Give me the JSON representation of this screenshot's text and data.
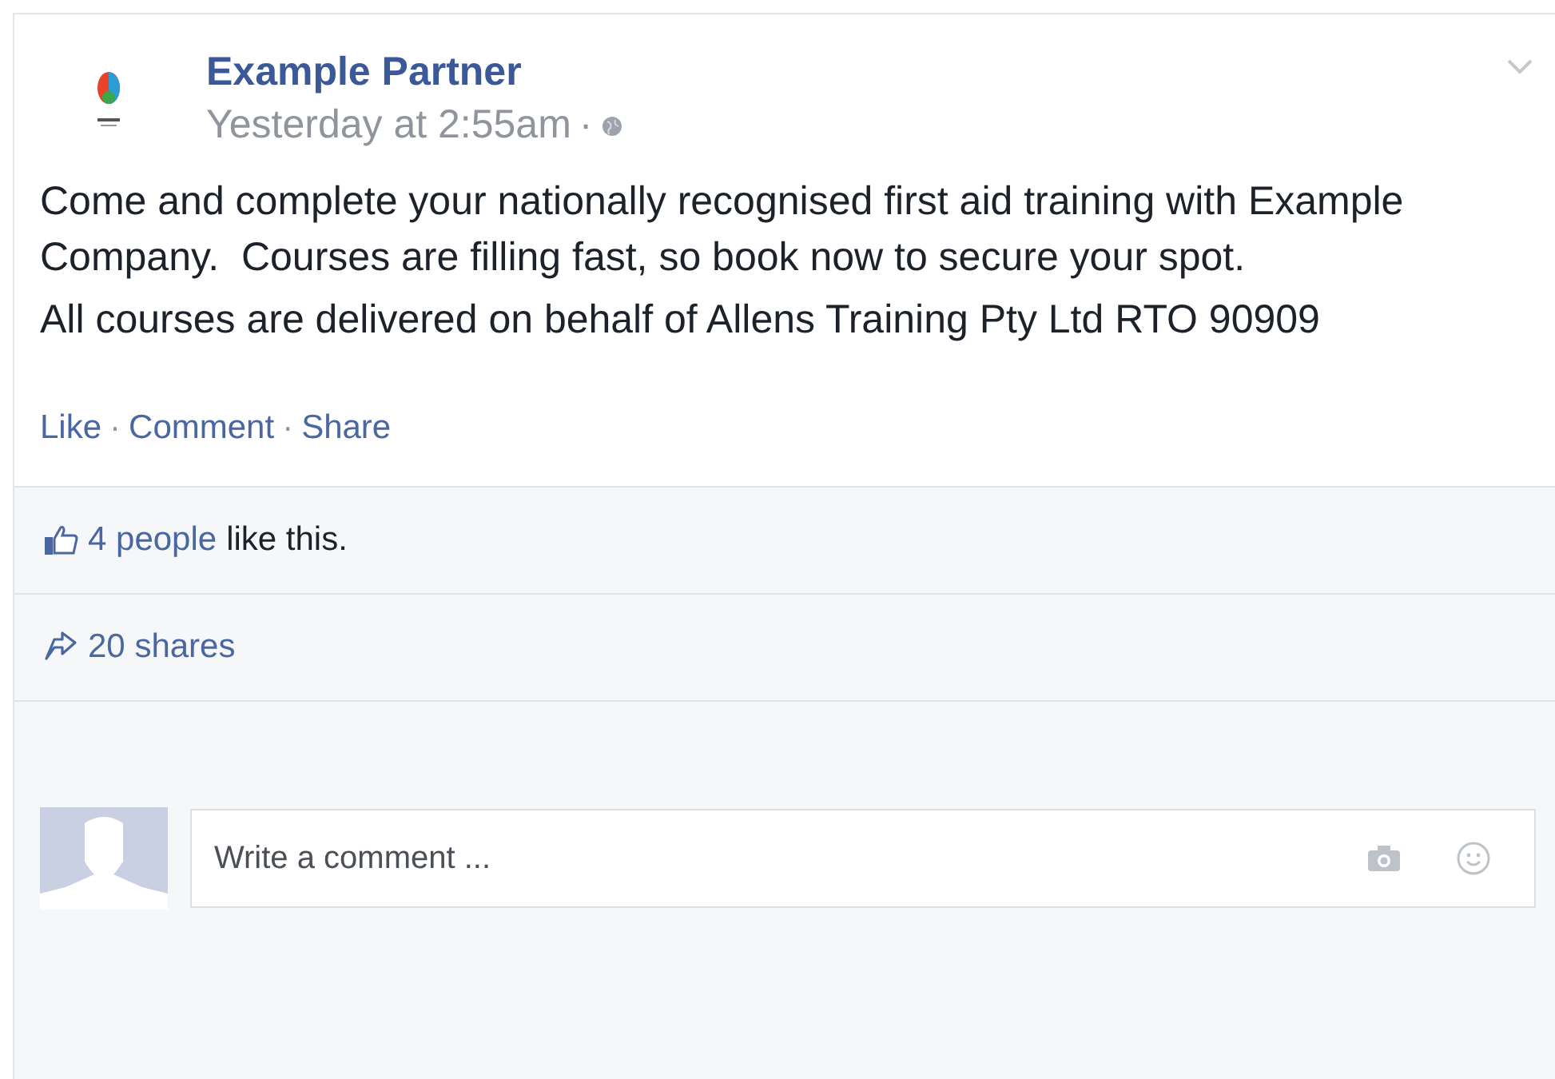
{
  "post": {
    "author": "Example Partner",
    "time": "Yesterday at 2:55am",
    "separator": "·",
    "paragraphs": [
      "Come and complete your nationally recognised first aid training with Example Company.  Courses are filling fast, so book now to secure your spot.",
      "All courses are delivered on behalf of Allens Training Pty Ltd RTO 90909"
    ],
    "actions": [
      {
        "kind": "link",
        "label": "Like"
      },
      {
        "kind": "separator",
        "label": "·"
      },
      {
        "kind": "link",
        "label": "Comment"
      },
      {
        "kind": "separator",
        "label": "·"
      },
      {
        "kind": "link",
        "label": "Share"
      }
    ],
    "likes": {
      "people": "4 people",
      "text": "like this."
    },
    "shares": "20 shares",
    "comment_box": {
      "placeholder": "Write a comment ..."
    }
  }
}
